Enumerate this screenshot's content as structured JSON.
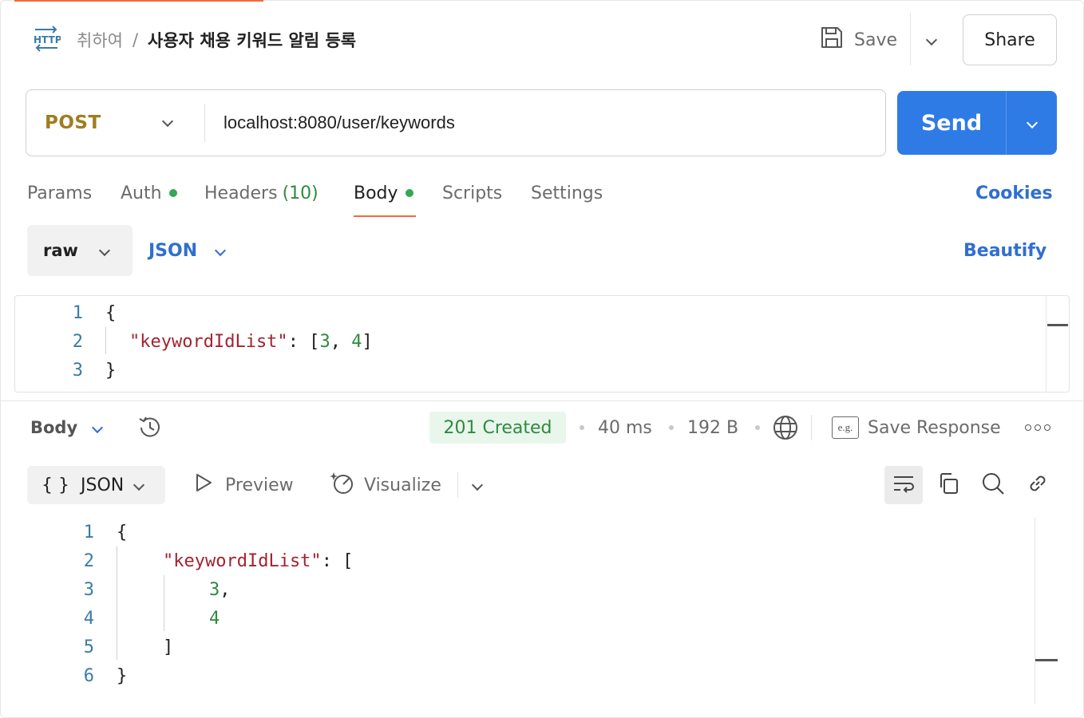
{
  "header": {
    "protocol_icon": "http-icon",
    "collection": "취하여",
    "separator": "/",
    "request_name": "사용자 채용 키워드 알림 등록",
    "save_label": "Save",
    "share_label": "Share"
  },
  "request": {
    "method": "POST",
    "url": "localhost:8080/user/keywords",
    "send_label": "Send"
  },
  "request_tabs": [
    {
      "label": "Params"
    },
    {
      "label": "Auth"
    },
    {
      "label": "Headers",
      "count": "(10)"
    },
    {
      "label": "Body"
    },
    {
      "label": "Scripts"
    },
    {
      "label": "Settings"
    }
  ],
  "cookies_label": "Cookies",
  "body_mode": {
    "mode": "raw",
    "language": "JSON",
    "beautify_label": "Beautify"
  },
  "request_body": {
    "line_numbers": [
      "1",
      "2",
      "3"
    ],
    "lines": {
      "open": "{",
      "key": "\"keywordIdList\"",
      "colon": ": [",
      "n1": "3",
      "comma": ", ",
      "n2": "4",
      "close_arr": "]",
      "close": "}"
    }
  },
  "response": {
    "view_label": "Body",
    "status": "201 Created",
    "time": "40 ms",
    "size": "192 B",
    "save_response_label": "Save Response",
    "eg_label": "e.g.",
    "format_label": "JSON",
    "format_icon_text": "{ }",
    "preview_label": "Preview",
    "visualize_label": "Visualize",
    "line_numbers": [
      "1",
      "2",
      "3",
      "4",
      "5",
      "6"
    ],
    "lines": {
      "l1": "{",
      "key": "\"keywordIdList\"",
      "colon": ": [",
      "n1": "3",
      "comma": ",",
      "n2": "4",
      "l5": "]",
      "l6": "}"
    }
  },
  "colors": {
    "accent": "#f26b3a",
    "send_blue": "#2f7be5",
    "link_blue": "#2f6fd0",
    "method_post": "#a07d20",
    "status_green": "#2e8a3e",
    "json_key": "#a3232f"
  }
}
